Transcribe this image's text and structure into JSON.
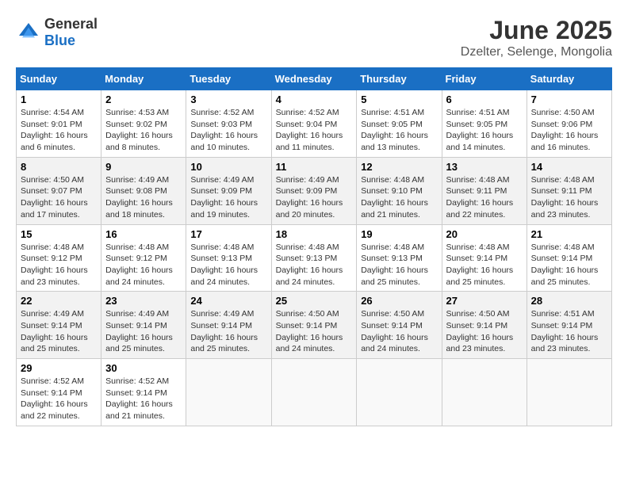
{
  "logo": {
    "general": "General",
    "blue": "Blue"
  },
  "title": "June 2025",
  "location": "Dzelter, Selenge, Mongolia",
  "days_of_week": [
    "Sunday",
    "Monday",
    "Tuesday",
    "Wednesday",
    "Thursday",
    "Friday",
    "Saturday"
  ],
  "weeks": [
    [
      {
        "day": "1",
        "sunrise": "Sunrise: 4:54 AM",
        "sunset": "Sunset: 9:01 PM",
        "daylight": "Daylight: 16 hours and 6 minutes."
      },
      {
        "day": "2",
        "sunrise": "Sunrise: 4:53 AM",
        "sunset": "Sunset: 9:02 PM",
        "daylight": "Daylight: 16 hours and 8 minutes."
      },
      {
        "day": "3",
        "sunrise": "Sunrise: 4:52 AM",
        "sunset": "Sunset: 9:03 PM",
        "daylight": "Daylight: 16 hours and 10 minutes."
      },
      {
        "day": "4",
        "sunrise": "Sunrise: 4:52 AM",
        "sunset": "Sunset: 9:04 PM",
        "daylight": "Daylight: 16 hours and 11 minutes."
      },
      {
        "day": "5",
        "sunrise": "Sunrise: 4:51 AM",
        "sunset": "Sunset: 9:05 PM",
        "daylight": "Daylight: 16 hours and 13 minutes."
      },
      {
        "day": "6",
        "sunrise": "Sunrise: 4:51 AM",
        "sunset": "Sunset: 9:05 PM",
        "daylight": "Daylight: 16 hours and 14 minutes."
      },
      {
        "day": "7",
        "sunrise": "Sunrise: 4:50 AM",
        "sunset": "Sunset: 9:06 PM",
        "daylight": "Daylight: 16 hours and 16 minutes."
      }
    ],
    [
      {
        "day": "8",
        "sunrise": "Sunrise: 4:50 AM",
        "sunset": "Sunset: 9:07 PM",
        "daylight": "Daylight: 16 hours and 17 minutes."
      },
      {
        "day": "9",
        "sunrise": "Sunrise: 4:49 AM",
        "sunset": "Sunset: 9:08 PM",
        "daylight": "Daylight: 16 hours and 18 minutes."
      },
      {
        "day": "10",
        "sunrise": "Sunrise: 4:49 AM",
        "sunset": "Sunset: 9:09 PM",
        "daylight": "Daylight: 16 hours and 19 minutes."
      },
      {
        "day": "11",
        "sunrise": "Sunrise: 4:49 AM",
        "sunset": "Sunset: 9:09 PM",
        "daylight": "Daylight: 16 hours and 20 minutes."
      },
      {
        "day": "12",
        "sunrise": "Sunrise: 4:48 AM",
        "sunset": "Sunset: 9:10 PM",
        "daylight": "Daylight: 16 hours and 21 minutes."
      },
      {
        "day": "13",
        "sunrise": "Sunrise: 4:48 AM",
        "sunset": "Sunset: 9:11 PM",
        "daylight": "Daylight: 16 hours and 22 minutes."
      },
      {
        "day": "14",
        "sunrise": "Sunrise: 4:48 AM",
        "sunset": "Sunset: 9:11 PM",
        "daylight": "Daylight: 16 hours and 23 minutes."
      }
    ],
    [
      {
        "day": "15",
        "sunrise": "Sunrise: 4:48 AM",
        "sunset": "Sunset: 9:12 PM",
        "daylight": "Daylight: 16 hours and 23 minutes."
      },
      {
        "day": "16",
        "sunrise": "Sunrise: 4:48 AM",
        "sunset": "Sunset: 9:12 PM",
        "daylight": "Daylight: 16 hours and 24 minutes."
      },
      {
        "day": "17",
        "sunrise": "Sunrise: 4:48 AM",
        "sunset": "Sunset: 9:13 PM",
        "daylight": "Daylight: 16 hours and 24 minutes."
      },
      {
        "day": "18",
        "sunrise": "Sunrise: 4:48 AM",
        "sunset": "Sunset: 9:13 PM",
        "daylight": "Daylight: 16 hours and 24 minutes."
      },
      {
        "day": "19",
        "sunrise": "Sunrise: 4:48 AM",
        "sunset": "Sunset: 9:13 PM",
        "daylight": "Daylight: 16 hours and 25 minutes."
      },
      {
        "day": "20",
        "sunrise": "Sunrise: 4:48 AM",
        "sunset": "Sunset: 9:14 PM",
        "daylight": "Daylight: 16 hours and 25 minutes."
      },
      {
        "day": "21",
        "sunrise": "Sunrise: 4:48 AM",
        "sunset": "Sunset: 9:14 PM",
        "daylight": "Daylight: 16 hours and 25 minutes."
      }
    ],
    [
      {
        "day": "22",
        "sunrise": "Sunrise: 4:49 AM",
        "sunset": "Sunset: 9:14 PM",
        "daylight": "Daylight: 16 hours and 25 minutes."
      },
      {
        "day": "23",
        "sunrise": "Sunrise: 4:49 AM",
        "sunset": "Sunset: 9:14 PM",
        "daylight": "Daylight: 16 hours and 25 minutes."
      },
      {
        "day": "24",
        "sunrise": "Sunrise: 4:49 AM",
        "sunset": "Sunset: 9:14 PM",
        "daylight": "Daylight: 16 hours and 25 minutes."
      },
      {
        "day": "25",
        "sunrise": "Sunrise: 4:50 AM",
        "sunset": "Sunset: 9:14 PM",
        "daylight": "Daylight: 16 hours and 24 minutes."
      },
      {
        "day": "26",
        "sunrise": "Sunrise: 4:50 AM",
        "sunset": "Sunset: 9:14 PM",
        "daylight": "Daylight: 16 hours and 24 minutes."
      },
      {
        "day": "27",
        "sunrise": "Sunrise: 4:50 AM",
        "sunset": "Sunset: 9:14 PM",
        "daylight": "Daylight: 16 hours and 23 minutes."
      },
      {
        "day": "28",
        "sunrise": "Sunrise: 4:51 AM",
        "sunset": "Sunset: 9:14 PM",
        "daylight": "Daylight: 16 hours and 23 minutes."
      }
    ],
    [
      {
        "day": "29",
        "sunrise": "Sunrise: 4:52 AM",
        "sunset": "Sunset: 9:14 PM",
        "daylight": "Daylight: 16 hours and 22 minutes."
      },
      {
        "day": "30",
        "sunrise": "Sunrise: 4:52 AM",
        "sunset": "Sunset: 9:14 PM",
        "daylight": "Daylight: 16 hours and 21 minutes."
      },
      null,
      null,
      null,
      null,
      null
    ]
  ]
}
